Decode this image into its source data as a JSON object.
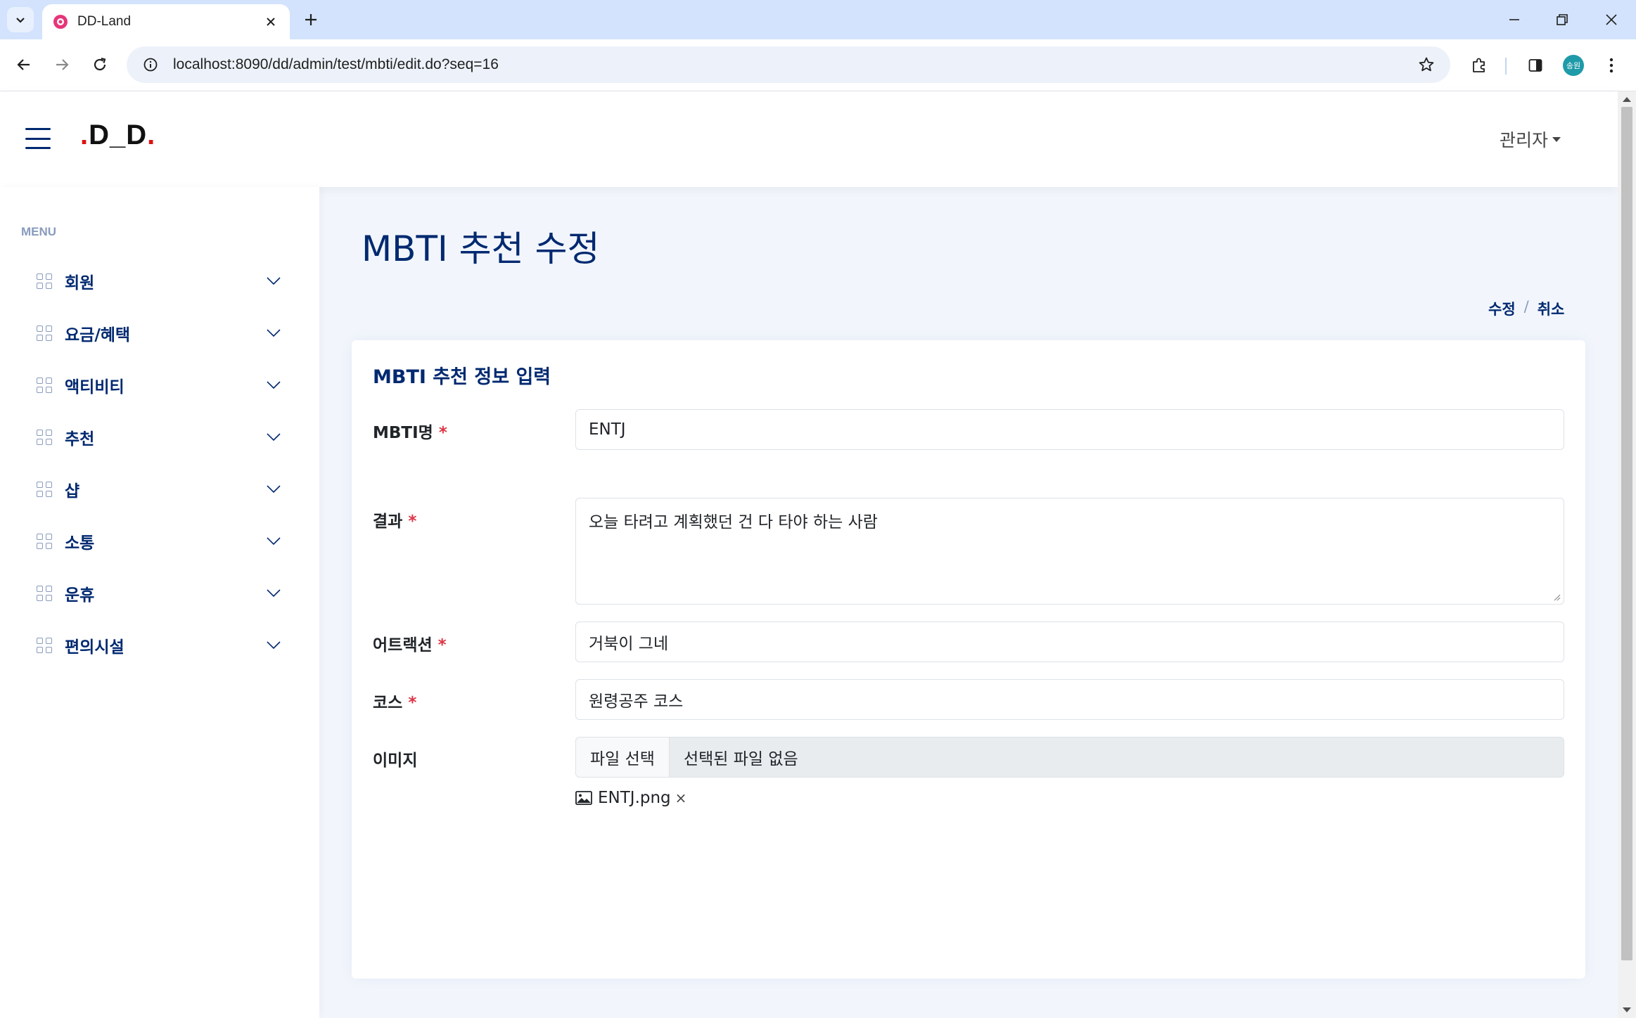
{
  "browser": {
    "tab_title": "DD-Land",
    "url": "localhost:8090/dd/admin/test/mbti/edit.do?seq=16",
    "profile_initials": "송원"
  },
  "header": {
    "logo_dot1": ".",
    "logo_text": "D_D",
    "logo_dot2": ".",
    "user_menu": "관리자"
  },
  "sidebar": {
    "heading": "MENU",
    "items": [
      {
        "label": "회원"
      },
      {
        "label": "요금/혜택"
      },
      {
        "label": "액티비티"
      },
      {
        "label": "추천"
      },
      {
        "label": "샵"
      },
      {
        "label": "소통"
      },
      {
        "label": "운휴"
      },
      {
        "label": "편의시설"
      }
    ]
  },
  "main": {
    "page_title": "MBTI 추천 수정",
    "actions": {
      "edit": "수정",
      "separator": "/",
      "cancel": "취소"
    },
    "card_title": "MBTI 추천 정보 입력",
    "required_mark": "*",
    "fields": {
      "mbti": {
        "label": "MBTI명",
        "value": "ENTJ"
      },
      "result": {
        "label": "결과",
        "value": "오늘 타려고 계획했던 건 다 타야 하는 사람"
      },
      "attraction": {
        "label": "어트랙션",
        "value": "거북이 그네"
      },
      "course": {
        "label": "코스",
        "value": "원령공주 코스"
      },
      "image": {
        "label": "이미지",
        "button": "파일 선택",
        "status": "선택된 파일 없음"
      }
    },
    "attachment": {
      "filename": "ENTJ.png",
      "remove": "×"
    }
  },
  "colors": {
    "primary": "#012970",
    "muted": "#899bbd",
    "required": "#dc3545",
    "background": "#f2f6fc",
    "chrome": "#d3e3fd"
  }
}
